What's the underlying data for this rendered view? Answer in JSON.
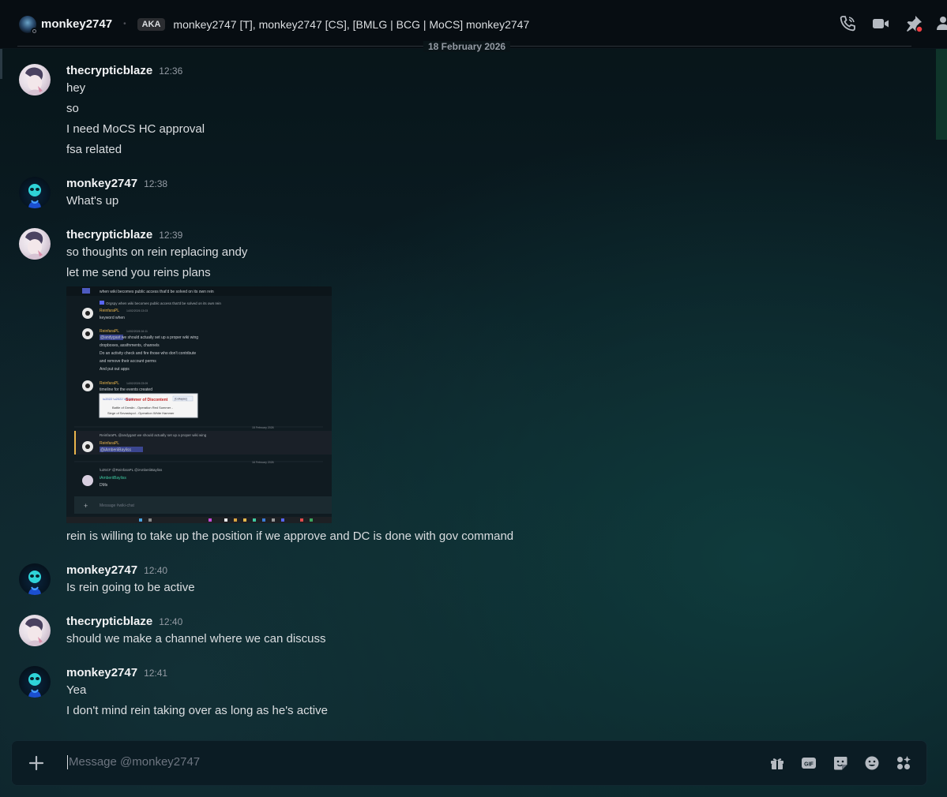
{
  "header": {
    "username": "monkey2747",
    "aka_label": "AKA",
    "aka_names": "monkey2747 [T], monkey2747 [CS], [BMLG | BCG | MoCS] monkey2747",
    "icons": [
      "phone-call-icon",
      "video-call-icon",
      "pinned-messages-icon",
      "add-friends-icon"
    ]
  },
  "date_divider": "18 February 2026",
  "messages": [
    {
      "author": "thecrypticblaze",
      "time": "12:36",
      "lines": [
        "hey",
        "so",
        "I need MoCS HC approval",
        "fsa related"
      ]
    },
    {
      "author": "monkey2747",
      "time": "12:38",
      "lines": [
        "What's up"
      ]
    },
    {
      "author": "thecrypticblaze",
      "time": "12:39",
      "lines": [
        "so thoughts on rein replacing andy",
        "let me send you reins plans",
        "rein is willing to take up the position if we approve and DC is done with gov command"
      ]
    },
    {
      "author": "monkey2747",
      "time": "12:40",
      "lines": [
        "Is rein going to be active"
      ]
    },
    {
      "author": "thecrypticblaze",
      "time": "12:40",
      "lines": [
        "should we make a channel where we can discuss"
      ]
    },
    {
      "author": "monkey2747",
      "time": "12:41",
      "lines": [
        "Yea",
        "I don't mind rein taking over as long as he's active"
      ]
    }
  ],
  "attachment": {
    "lines": [
      "when wiki becomes public access that'd be solved on its own rein",
      "ReinfaraPL",
      "keyword when",
      "ReinfaraPL",
      "@andygast we should actually set up a proper wiki wing",
      "dropboxes, assifnments, channels",
      "Do an activity check and fire those who don't contribute",
      "and remove their account perms",
      "And put out apps",
      "ReinfaraPL",
      "timeline for the events created",
      "Summer of Discontent",
      "Battle of Greslin - Operation Red Summer -",
      "Siege of Sevastopol - Operation White Hammer",
      "15 February 2026",
      "ReinfaraPL",
      "@iAmberiiBayliss",
      "16 February 2026",
      "iAmberiiBayliss",
      "DMs",
      "Message #wiki-chat"
    ]
  },
  "composer": {
    "placeholder": "Message @monkey2747",
    "tools": [
      "gift-icon",
      "gif-icon",
      "sticker-icon",
      "emoji-icon",
      "apps-icon"
    ]
  }
}
